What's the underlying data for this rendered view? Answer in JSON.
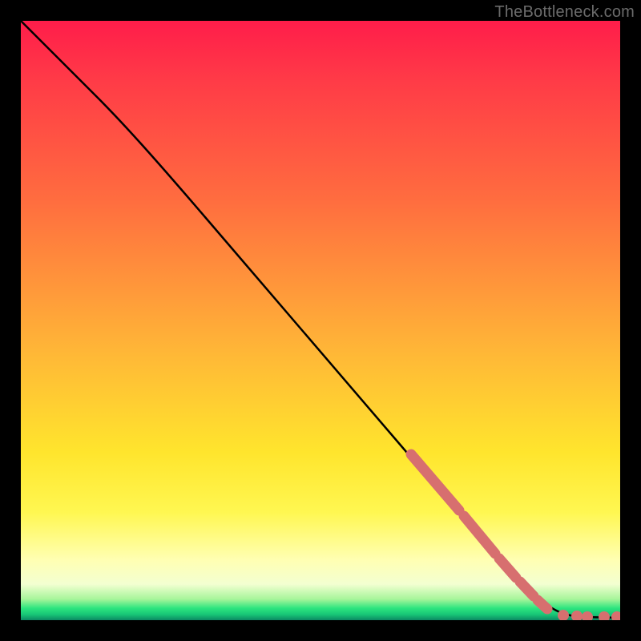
{
  "watermark": "TheBottleneck.com",
  "chart_data": {
    "type": "line",
    "title": "",
    "xlabel": "",
    "ylabel": "",
    "xlim": [
      0,
      100
    ],
    "ylim": [
      0,
      100
    ],
    "grid": false,
    "curve_points": [
      {
        "x": 0,
        "y": 100
      },
      {
        "x": 5,
        "y": 97
      },
      {
        "x": 12,
        "y": 91
      },
      {
        "x": 20,
        "y": 81
      },
      {
        "x": 30,
        "y": 69
      },
      {
        "x": 40,
        "y": 57
      },
      {
        "x": 50,
        "y": 45
      },
      {
        "x": 60,
        "y": 33
      },
      {
        "x": 70,
        "y": 21
      },
      {
        "x": 80,
        "y": 10
      },
      {
        "x": 86,
        "y": 3
      },
      {
        "x": 89,
        "y": 1
      },
      {
        "x": 92,
        "y": 0.5
      },
      {
        "x": 96,
        "y": 0.3
      },
      {
        "x": 100,
        "y": 0.2
      }
    ],
    "highlight_segments": [
      {
        "x1": 65,
        "y1": 27,
        "x2": 73,
        "y2": 17.5
      },
      {
        "x1": 73.5,
        "y1": 17,
        "x2": 79,
        "y2": 10.5
      },
      {
        "x1": 79.5,
        "y1": 10,
        "x2": 82,
        "y2": 7
      },
      {
        "x1": 82.5,
        "y1": 6.5,
        "x2": 85,
        "y2": 3.7
      },
      {
        "x1": 85.5,
        "y1": 3.3,
        "x2": 87.5,
        "y2": 1.6
      }
    ],
    "highlight_points": [
      {
        "x": 90.5,
        "y": 0.6
      },
      {
        "x": 93.0,
        "y": 0.4
      },
      {
        "x": 94.5,
        "y": 0.35
      },
      {
        "x": 97.5,
        "y": 0.3
      },
      {
        "x": 99.5,
        "y": 0.25
      }
    ],
    "colors": {
      "curve": "#000000",
      "highlight": "#d76f6f"
    }
  }
}
